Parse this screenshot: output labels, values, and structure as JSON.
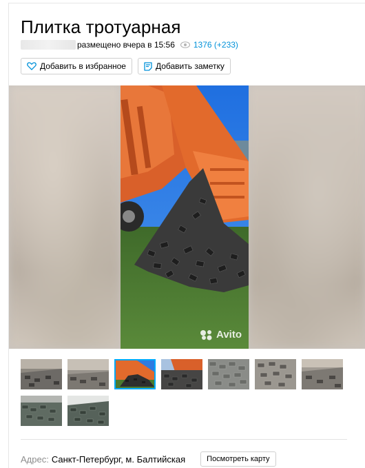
{
  "listing": {
    "title": "Плитка тротуарная",
    "posted": "размещено вчера в 15:56",
    "views": "1376 (+233)"
  },
  "actions": {
    "favorite_label": "Добавить в избранное",
    "note_label": "Добавить заметку"
  },
  "gallery": {
    "watermark": "Avito",
    "thumbnail_count": 9,
    "active_thumbnail": 3
  },
  "address": {
    "label": "Адрес:",
    "value": "Санкт-Петербург, м. Балтийская",
    "map_button": "Посмотреть карту"
  },
  "colors": {
    "link": "#0091d9",
    "thumb_selected": "#00aaff",
    "truck_orange": "#e2632a",
    "sky": "#2f7be0"
  }
}
